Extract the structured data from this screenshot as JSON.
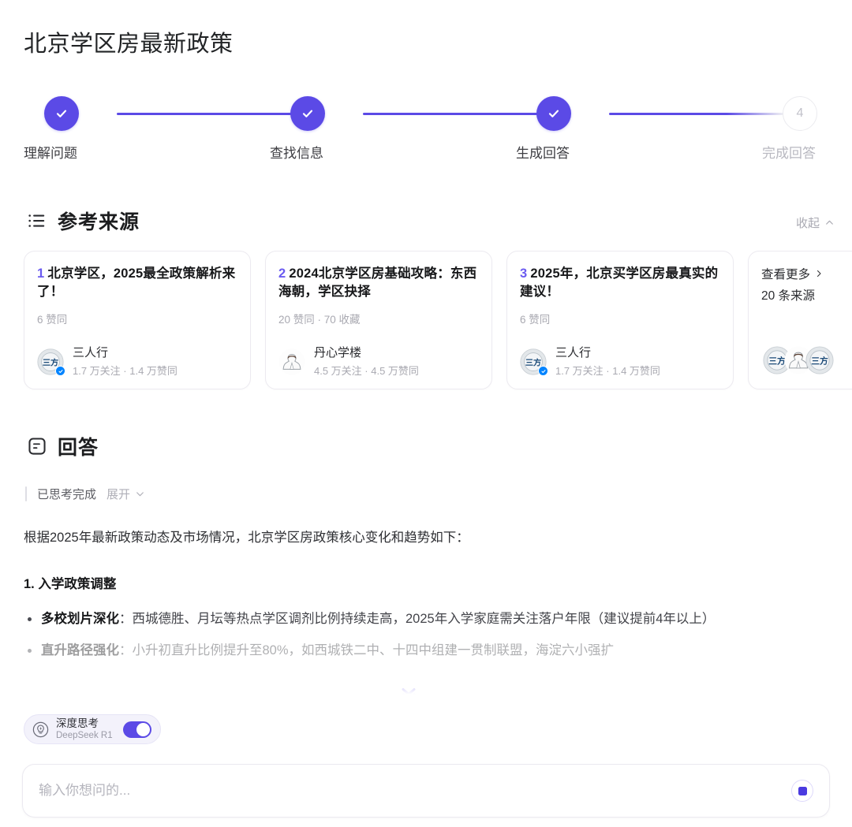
{
  "page": {
    "title": "北京学区房最新政策"
  },
  "stepper": {
    "steps": [
      {
        "label": "理解问题",
        "state": "done",
        "num": "1",
        "icon": "check-icon"
      },
      {
        "label": "查找信息",
        "state": "done",
        "num": "2",
        "icon": "check-icon"
      },
      {
        "label": "生成回答",
        "state": "done",
        "num": "3",
        "icon": "check-icon"
      },
      {
        "label": "完成回答",
        "state": "todo",
        "num": "4",
        "icon": ""
      }
    ],
    "accent_color": "#5b4ae6",
    "inactive_color": "#ebebef"
  },
  "sources": {
    "heading": "参考来源",
    "heading_icon": "list-icon",
    "collapse_label": "收起",
    "collapse_icon": "chevron-up-icon",
    "items": [
      {
        "index": "1",
        "title": "北京学区，2025最全政策解析来了！",
        "meta": "6 赞同",
        "author": "三人行",
        "author_stat": "1.7 万关注 · 1.4 万赞同",
        "verified": true,
        "avatar": "logo-avatar"
      },
      {
        "index": "2",
        "title": "2024北京学区房基础攻略：东西海朝，学区抉择",
        "meta": "20 赞同 · 70 收藏",
        "author": "丹心学楼",
        "author_stat": "4.5 万关注 · 4.5 万赞同",
        "verified": false,
        "avatar": "person-avatar"
      },
      {
        "index": "3",
        "title": "2025年，北京买学区房最真实的建议！",
        "meta": "6 赞同",
        "author": "三人行",
        "author_stat": "1.7 万关注 · 1.4 万赞同",
        "verified": true,
        "avatar": "logo-avatar"
      }
    ],
    "more": {
      "link_label": "查看更多",
      "link_icon": "chevron-right-icon",
      "count_label": "20 条来源",
      "avatars": [
        "logo-avatar",
        "person-avatar",
        "logo-avatar"
      ]
    }
  },
  "answer": {
    "heading": "回答",
    "heading_icon": "document-icon",
    "thinking_status": "已思考完成",
    "expand_label": "展开",
    "expand_icon": "chevron-down-icon",
    "intro": "根据2025年最新政策动态及市场情况，北京学区房政策核心变化和趋势如下：",
    "section_heading": "1. 入学政策调整",
    "bullets": [
      {
        "strong": "多校划片深化",
        "text": "：西城德胜、月坛等热点学区调剂比例持续走高，2025年入学家庭需关注落户年限（建议提前4年以上）"
      },
      {
        "strong": "直升路径强化",
        "text": "：小升初直升比例提升至80%，如西城铁二中、十四中组建一贯制联盟，海淀六小强扩"
      }
    ],
    "scroll_icon": "double-chevron-down-icon"
  },
  "composer": {
    "deep_think": {
      "title": "深度思考",
      "subtitle": "DeepSeek R1",
      "icon": "lightbulb-bolt-icon",
      "enabled": true
    },
    "input_placeholder": "输入你想问的...",
    "input_value": "",
    "stop_button_icon": "stop-square-icon"
  }
}
